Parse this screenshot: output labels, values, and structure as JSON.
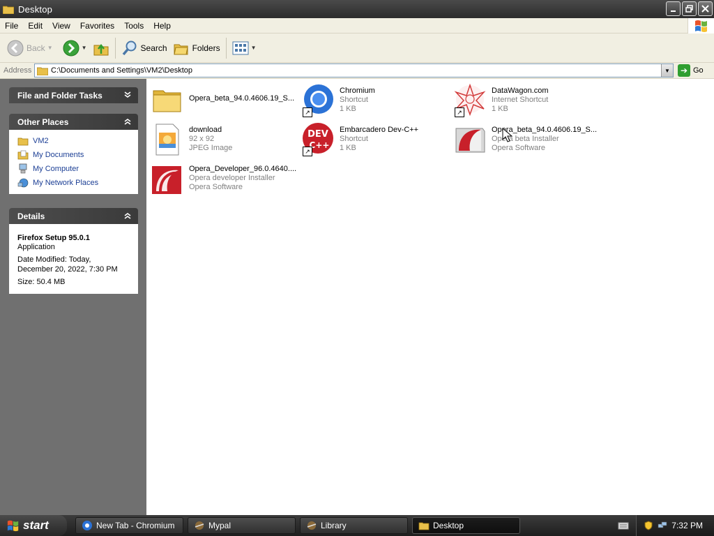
{
  "window": {
    "title": "Desktop"
  },
  "menu": [
    "File",
    "Edit",
    "View",
    "Favorites",
    "Tools",
    "Help"
  ],
  "toolbar": {
    "back_label": "Back",
    "search_label": "Search",
    "folders_label": "Folders"
  },
  "address": {
    "label": "Address",
    "value": "C:\\Documents and Settings\\VM2\\Desktop",
    "go_label": "Go"
  },
  "taskpane": {
    "file_tasks_title": "File and Folder Tasks",
    "other_places_title": "Other Places",
    "places": [
      "VM2",
      "My Documents",
      "My Computer",
      "My Network Places"
    ],
    "details_title": "Details",
    "details": {
      "name": "Firefox Setup 95.0.1",
      "type": "Application",
      "date_line1": "Date Modified: Today,",
      "date_line2": "December 20, 2022, 7:30 PM",
      "size": "Size: 50.4 MB"
    }
  },
  "files": [
    {
      "name": "Opera_beta_94.0.4606.19_S...",
      "sub1": "",
      "sub2": "",
      "icon": "folder-icon"
    },
    {
      "name": "Chromium",
      "sub1": "Shortcut",
      "sub2": "1 KB",
      "icon": "chromium-icon"
    },
    {
      "name": "DataWagon.com",
      "sub1": "Internet Shortcut",
      "sub2": "1 KB",
      "icon": "datawagon-icon"
    },
    {
      "name": "download",
      "sub1": "92 x 92",
      "sub2": "JPEG Image",
      "icon": "jpeg-image-icon"
    },
    {
      "name": "Embarcadero Dev-C++",
      "sub1": "Shortcut",
      "sub2": "1 KB",
      "icon": "devcpp-icon"
    },
    {
      "name": "Opera_beta_94.0.4606.19_S...",
      "sub1": "Opera beta Installer",
      "sub2": "Opera Software",
      "icon": "opera-installer-icon"
    },
    {
      "name": "Opera_Developer_96.0.4640....",
      "sub1": "Opera developer Installer",
      "sub2": "Opera Software",
      "icon": "opera-developer-icon"
    }
  ],
  "taskbar": {
    "start_label": "start",
    "tasks": [
      "New Tab - Chromium",
      "Mypal",
      "Library",
      "Desktop"
    ],
    "clock": "7:32 PM"
  }
}
